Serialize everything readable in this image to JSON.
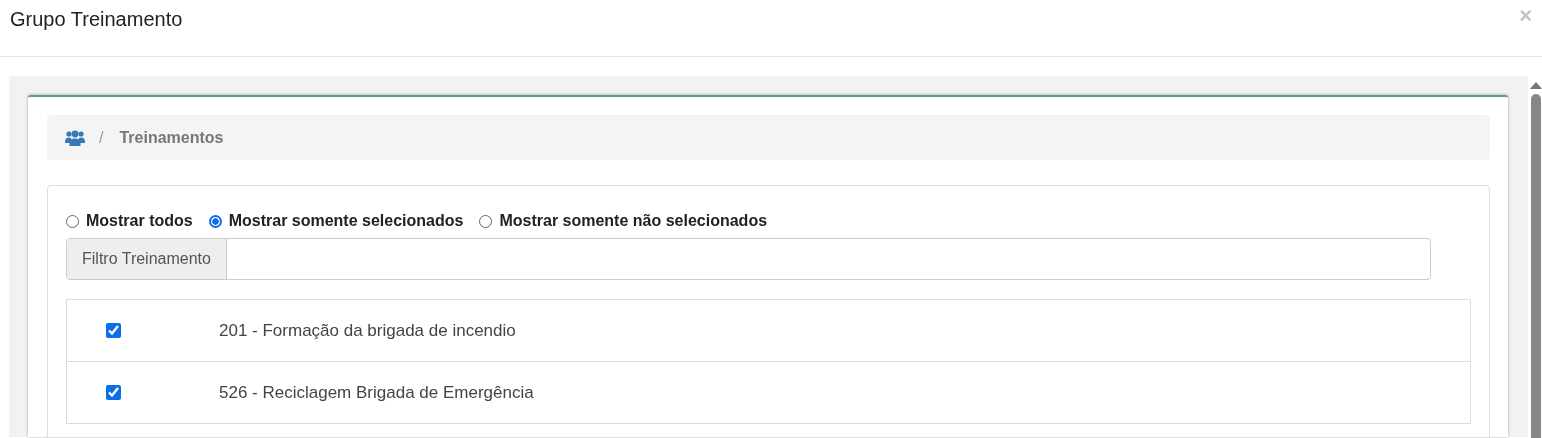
{
  "modal": {
    "title": "Grupo Treinamento",
    "close": "×"
  },
  "breadcrumb": {
    "separator": "/",
    "items": [
      {
        "label": "Treinamentos"
      }
    ]
  },
  "filter_options": [
    {
      "label": "Mostrar todos",
      "selected": false
    },
    {
      "label": "Mostrar somente selecionados",
      "selected": true
    },
    {
      "label": "Mostrar somente não selecionados",
      "selected": false
    }
  ],
  "search": {
    "label": "Filtro Treinamento"
  },
  "rows": [
    {
      "label": "201 - Formação da brigada de incendio",
      "checked": true
    },
    {
      "label": "526 - Reciclagem Brigada de Emergência",
      "checked": true
    }
  ]
}
